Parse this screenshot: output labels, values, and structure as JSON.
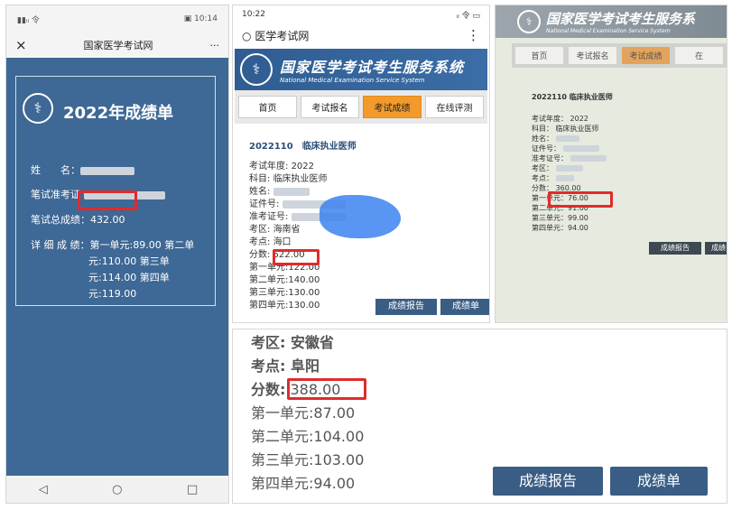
{
  "panel1": {
    "status_time": "10:14",
    "title": "国家医学考试网",
    "close_label": "×",
    "more_label": "···",
    "card_title": "2022年成绩单",
    "name_label": "姓　　名：",
    "ticket_label": "笔试准考证",
    "total_label": "笔试总成绩：",
    "total_value": "432.00",
    "detail_label": "详 细 成 绩：",
    "detail_lines": [
      "第一单元:89.00 第二单",
      "元:110.00 第三单",
      "元:114.00 第四单",
      "元:119.00"
    ],
    "nav_back": "◁",
    "nav_home": "○",
    "nav_recent": "□"
  },
  "panel2": {
    "status_time": "10:22",
    "search_title": "医学考试网",
    "menu_label": "⋮",
    "banner_title": "国家医学考试考生服务系统",
    "banner_subtitle": "National Medical Examination Service System",
    "nav": [
      "首页",
      "考试报名",
      "考试成绩",
      "在线评测"
    ],
    "heading": "2022110　临床执业医师",
    "rows": [
      {
        "label": "考试年度:",
        "value": "2022"
      },
      {
        "label": "科目:",
        "value": "临床执业医师"
      },
      {
        "label": "姓名:",
        "value": ""
      },
      {
        "label": "证件号:",
        "value": ""
      },
      {
        "label": "准考证号:",
        "value": ""
      },
      {
        "label": "考区:",
        "value": "海南省"
      },
      {
        "label": "考点:",
        "value": "海口"
      },
      {
        "label": "分数:",
        "value": "522.00"
      },
      {
        "label": "第一单元:",
        "value": "122.00"
      },
      {
        "label": "第二单元:",
        "value": "140.00"
      },
      {
        "label": "第三单元:",
        "value": "130.00"
      },
      {
        "label": "第四单元:",
        "value": "130.00"
      }
    ],
    "btn_report": "成绩报告",
    "btn_sheet": "成绩单"
  },
  "panel3": {
    "banner_title": "国家医学考试考生服务系",
    "banner_subtitle": "National Medical Examination Service System",
    "nav": [
      "首页",
      "考试报名",
      "考试成绩",
      "在"
    ],
    "heading": "2022110  临床执业医师",
    "rows": [
      "考试年度：  2022",
      "科目：   临床执业医师",
      "姓名：",
      "证件号：",
      "准考证号：",
      "考区：",
      "考点：",
      "分数：",
      "第一单元：76.00",
      "第二单元：91.00",
      "第三单元：99.00",
      "第四单元：94.00"
    ],
    "score": "360.00",
    "btn_report": "成绩报告",
    "btn_sheet": "成绩"
  },
  "panel4": {
    "lines": [
      "考区:   安徽省",
      "考点:   阜阳",
      "分数:",
      "第一单元:87.00",
      "第二单元:104.00",
      "第三单元:103.00",
      "第四单元:94.00"
    ],
    "score": "388.00",
    "btn_report": "成绩报告",
    "btn_sheet": "成绩单"
  }
}
